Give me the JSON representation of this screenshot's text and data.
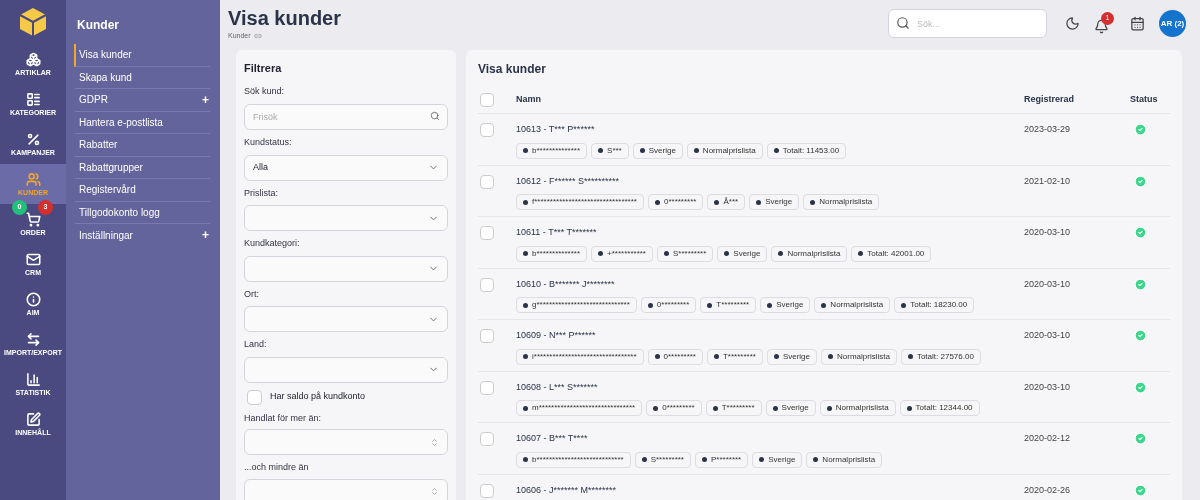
{
  "rail": {
    "items": [
      {
        "label": "ARTIKLAR",
        "selected": false
      },
      {
        "label": "KATEGORIER",
        "selected": false
      },
      {
        "label": "KAMPANJER",
        "selected": false
      },
      {
        "label": "KUNDER",
        "selected": true
      },
      {
        "label": "ORDER",
        "selected": false,
        "badges": [
          {
            "text": "0",
            "color": "#22c07a"
          },
          {
            "text": "3",
            "color": "#d32f2f"
          }
        ]
      },
      {
        "label": "CRM",
        "selected": false
      },
      {
        "label": "AIM",
        "selected": false
      },
      {
        "label": "IMPORT/EXPORT",
        "selected": false
      },
      {
        "label": "STATISTIK",
        "selected": false
      },
      {
        "label": "INNEHÅLL",
        "selected": false
      }
    ]
  },
  "submenu": {
    "title": "Kunder",
    "items": [
      {
        "label": "Visa kunder",
        "selected": true,
        "expandable": false
      },
      {
        "label": "Skapa kund",
        "selected": false,
        "expandable": false
      },
      {
        "label": "GDPR",
        "selected": false,
        "expandable": true
      },
      {
        "label": "Hantera e-postlista",
        "selected": false,
        "expandable": false
      },
      {
        "label": "Rabatter",
        "selected": false,
        "expandable": false
      },
      {
        "label": "Rabattgrupper",
        "selected": false,
        "expandable": false
      },
      {
        "label": "Registervård",
        "selected": false,
        "expandable": false
      },
      {
        "label": "Tillgodokonto logg",
        "selected": false,
        "expandable": false
      },
      {
        "label": "Inställningar",
        "selected": false,
        "expandable": true
      }
    ],
    "expand_mark": "+"
  },
  "header": {
    "title": "Visa kunder",
    "breadcrumb": "Kunder",
    "search_placeholder": "Sök...",
    "notification_count": "1",
    "avatar": "AR (2)"
  },
  "filter": {
    "title": "Filtrera",
    "fields": [
      {
        "kind": "search",
        "label": "Sök kund:",
        "placeholder": "Frisök"
      },
      {
        "kind": "select",
        "label": "Kundstatus:",
        "value": "Alla"
      },
      {
        "kind": "select",
        "label": "Prislista:"
      },
      {
        "kind": "select",
        "label": "Kundkategori:"
      },
      {
        "kind": "select",
        "label": "Ort:"
      },
      {
        "kind": "select",
        "label": "Land:"
      },
      {
        "kind": "checkbox",
        "label": "Har saldo på kundkonto",
        "checked": false
      },
      {
        "kind": "number",
        "label": "Handlat för mer än:"
      },
      {
        "kind": "number",
        "label": "...och mindre än"
      }
    ]
  },
  "table": {
    "title": "Visa kunder",
    "select_all_checked": false,
    "columns": [
      "Namn",
      "Registrerad",
      "Status"
    ],
    "rows": [
      {
        "checked": false,
        "name": "10613  - T*** P******",
        "tags": [
          "b**************",
          "S***",
          "Sverige",
          "Normalprislista",
          "Totalt: 11453.00"
        ],
        "registered": "2023-03-29",
        "active": true
      },
      {
        "checked": false,
        "name": "10612  - F****** S**********",
        "tags": [
          "f*********************************",
          "0*********",
          "Å***",
          "Sverige",
          "Normalprislista"
        ],
        "registered": "2021-02-10",
        "active": true
      },
      {
        "checked": false,
        "name": "10611  - T*** T*******",
        "tags": [
          "b**************",
          "+***********",
          "S*********",
          "Sverige",
          "Normalprislista",
          "Totalt: 42001.00"
        ],
        "registered": "2020-03-10",
        "active": true
      },
      {
        "checked": false,
        "name": "10610  - B******* J********",
        "tags": [
          "g******************************",
          "0*********",
          "T*********",
          "Sverige",
          "Normalprislista",
          "Totalt: 18230.00"
        ],
        "registered": "2020-03-10",
        "active": true
      },
      {
        "checked": false,
        "name": "10609  - N*** P******",
        "tags": [
          "i*********************************",
          "0*********",
          "T*********",
          "Sverige",
          "Normalprislista",
          "Totalt: 27576.00"
        ],
        "registered": "2020-03-10",
        "active": true
      },
      {
        "checked": false,
        "name": "10608  - L*** S*******",
        "tags": [
          "m*******************************",
          "0*********",
          "T*********",
          "Sverige",
          "Normalprislista",
          "Totalt: 12344.00"
        ],
        "registered": "2020-03-10",
        "active": true
      },
      {
        "checked": false,
        "name": "10607  - B*** T****",
        "tags": [
          "b****************************",
          "S*********",
          "P********",
          "Sverige",
          "Normalprislista"
        ],
        "registered": "2020-02-12",
        "active": true
      },
      {
        "checked": false,
        "name": "10606  - J******* M********",
        "registered": "2020-02-26",
        "active": true
      }
    ]
  }
}
